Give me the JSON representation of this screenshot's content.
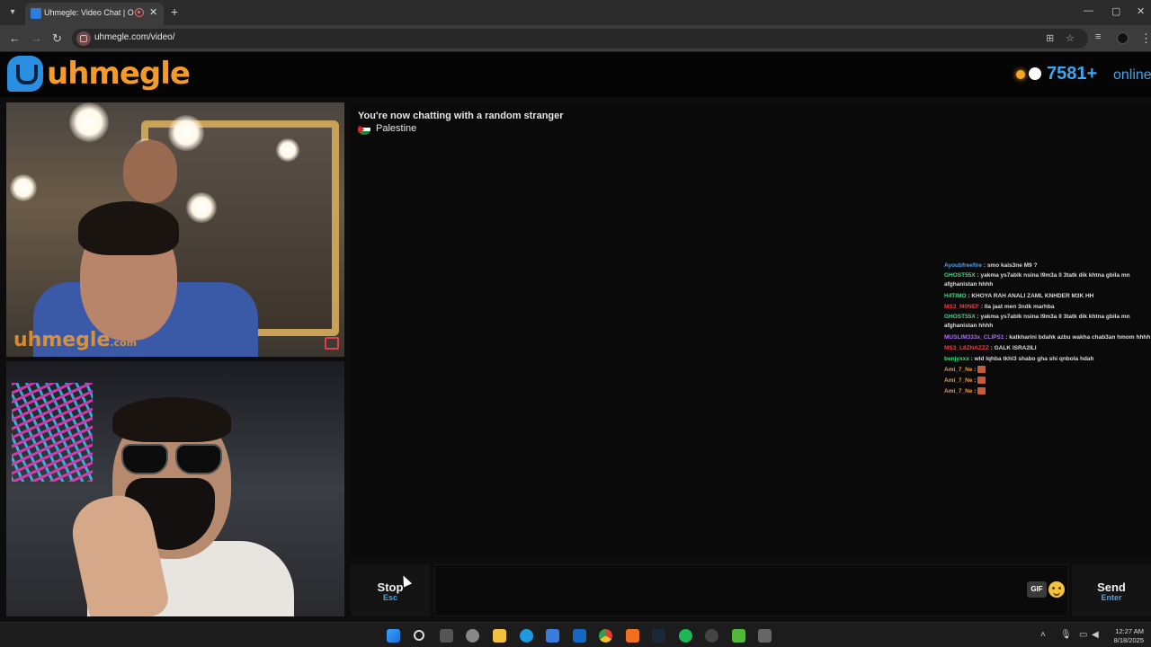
{
  "browser": {
    "tab_title": "Uhmegle: Video Chat | Omegle",
    "url": "uhmegle.com/video/",
    "new_tab": "+",
    "tab_close": "✕",
    "minimize": "—",
    "maximize": "▢",
    "close": "✕"
  },
  "site": {
    "logo": "uhmegle",
    "online_count": "7581",
    "online_plus": "+",
    "online_label": "online"
  },
  "videos": {
    "watermark": "uhmegle",
    "watermark_suffix": ".com"
  },
  "chat": {
    "status": "You're now chatting with a random stranger",
    "country": "Palestine"
  },
  "live_chat": [
    {
      "user": "Ayoubfreefire",
      "color": "#4aa3ff",
      "text": ": smo kais3ne M9 ?",
      "wrap": false
    },
    {
      "user": "GHOST55X",
      "color": "#3ddc84",
      "text": ": yakma ys7ablk nsina l9m3a ll 3tatk dik khtna gbila mn afghanistan hhhh",
      "wrap": true
    },
    {
      "user": "H4TIMO",
      "color": "#3ddc84",
      "text": ": KHOYA RAH ANALI ZAML KNHDER M3K HH",
      "wrap": false
    },
    {
      "user": "MS3_M0NEF",
      "color": "#e0404a",
      "text": ": lla jaat men 3ndk marhba",
      "wrap": false
    },
    {
      "user": "GHOST55X",
      "color": "#3ddc84",
      "text": ": yakma ys7ablk nsina l9m3a ll 3tatk dik khtna gbila mn afghanistan hhhh",
      "wrap": true
    },
    {
      "user": "MUSLIM333x_CLIPS1",
      "color": "#b06cff",
      "text": ": katkharini bdahk azbu wakha chab3an hmom hhhh",
      "wrap": false
    },
    {
      "user": "MS3_L8ZNAZZZ",
      "color": "#e0404a",
      "text": ": GALK ISRA2ILI",
      "wrap": false
    },
    {
      "user": "benjyxxx",
      "color": "#3ddc84",
      "text": ": wld lqhba tkhl3 shabo gha shi qnbola hdah",
      "wrap": false
    },
    {
      "user": "Ami_7_Ne",
      "color": "#f39a2c",
      "text": ":",
      "wrap": false,
      "sticker": true
    },
    {
      "user": "Ami_7_Ne",
      "color": "#f39a2c",
      "text": ":",
      "wrap": false,
      "sticker": true
    },
    {
      "user": "Ami_7_Ne",
      "color": "#f39a2c",
      "text": ":",
      "wrap": false,
      "sticker": true
    }
  ],
  "controls": {
    "stop_label": "Stop",
    "stop_key": "Esc",
    "gif_label": "GIF",
    "send_label": "Send",
    "send_key": "Enter"
  },
  "taskbar": {
    "time": "12:27 AM",
    "date": "8/18/2025"
  },
  "colors": {
    "brand_orange": "#f39a2c",
    "brand_blue": "#3fa6f0"
  }
}
